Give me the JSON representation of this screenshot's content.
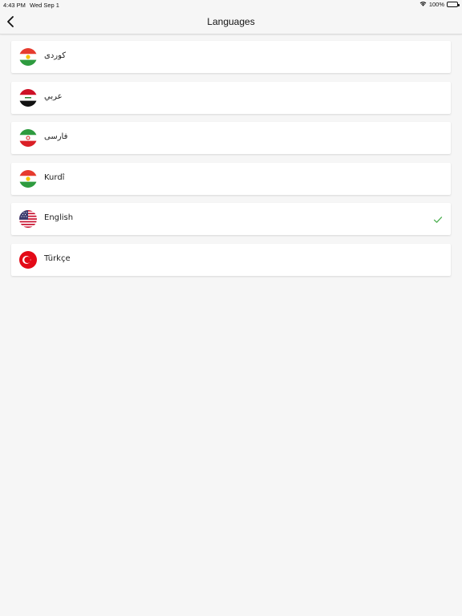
{
  "status_bar": {
    "time": "4:43 PM",
    "date": "Wed Sep 1",
    "battery": "100%",
    "icons": [
      "wifi-icon",
      "battery-icon"
    ]
  },
  "nav": {
    "title": "Languages",
    "back_icon": "chevron-left-icon"
  },
  "languages": [
    {
      "label": "کوردی",
      "flag": "kurdistan",
      "selected": false
    },
    {
      "label": "عربي",
      "flag": "iraq",
      "selected": false
    },
    {
      "label": "فارسی",
      "flag": "iran",
      "selected": false
    },
    {
      "label": "Kurdî",
      "flag": "kurdistan",
      "selected": false
    },
    {
      "label": "English",
      "flag": "usa",
      "selected": true
    },
    {
      "label": "Türkçe",
      "flag": "turkey",
      "selected": false
    }
  ],
  "colors": {
    "check": "#4caf50",
    "background": "#f6f6f6"
  }
}
